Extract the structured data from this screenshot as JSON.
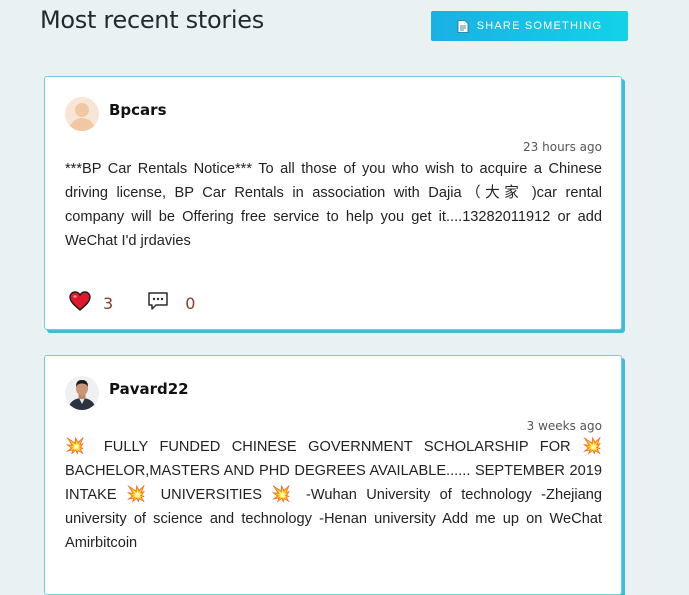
{
  "page": {
    "heading": "Most recent stories",
    "share_button_label": "SHARE SOMETHING"
  },
  "stories": [
    {
      "author": "Bpcars",
      "time": "23 hours ago",
      "text": "***BP Car Rentals Notice*** To all those of you who wish to acquire a Chinese driving license, BP Car Rentals in association with Dajia（大家 )car rental company will be Offering free service to help you get it....13282011912 or add WeChat I'd jrdavies",
      "likes": "3",
      "comments": "0"
    },
    {
      "author": "Pavard22",
      "time": "3 weeks ago",
      "text_parts": {
        "p1": " FULLY FUNDED CHINESE  GOVERNMENT SCHOLARSHIP FOR ",
        "p2": " BACHELOR,MASTERS AND PHD DEGREES AVAILABLE...... SEPTEMBER 2019 INTAKE ",
        "p3": " UNIVERSITIES ",
        "p4": "  -Wuhan University of technology -Zhejiang university of science and  technology -Henan university Add me up on WeChat Amirbitcoin",
        "emoji": "💥"
      }
    }
  ],
  "colors": {
    "accent": "#1ab0e4",
    "card_border": "#3fbcd6",
    "like_heart": "#e0182d",
    "count_text": "#8a3b2e"
  },
  "icons": {
    "share": "document-icon",
    "like": "heart-icon",
    "comment": "comment-bubble-icon"
  }
}
